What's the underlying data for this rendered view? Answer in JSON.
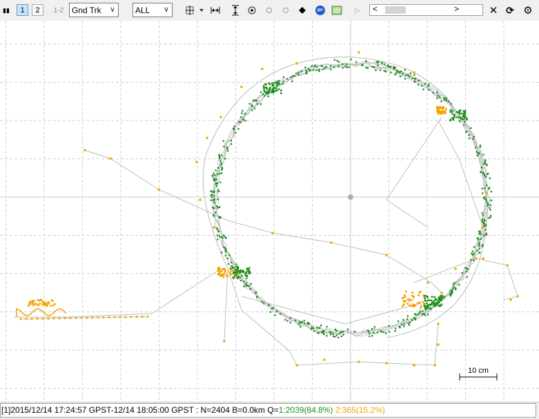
{
  "toolbar": {
    "pause_label": "▮▮",
    "btn1_label": "1",
    "btn2_label": "2",
    "btn12_label": "1-2",
    "plot_type_value": "Gnd Trk",
    "quality_value": "ALL"
  },
  "plot": {
    "scale_label": "10 cm"
  },
  "status": {
    "prefix": "[1]",
    "time_range": "2015/12/14 17:24:57 GPST-12/14 18:05:00 GPST",
    "counts": " : N=2404 B=0.0km Q=",
    "q1": "1:2039(84.8%)",
    "q2": "2:365(15.2%)"
  },
  "colors": {
    "fix": "#1a8f1a",
    "float": "#f5a200",
    "track": "#bdbdbd"
  }
}
